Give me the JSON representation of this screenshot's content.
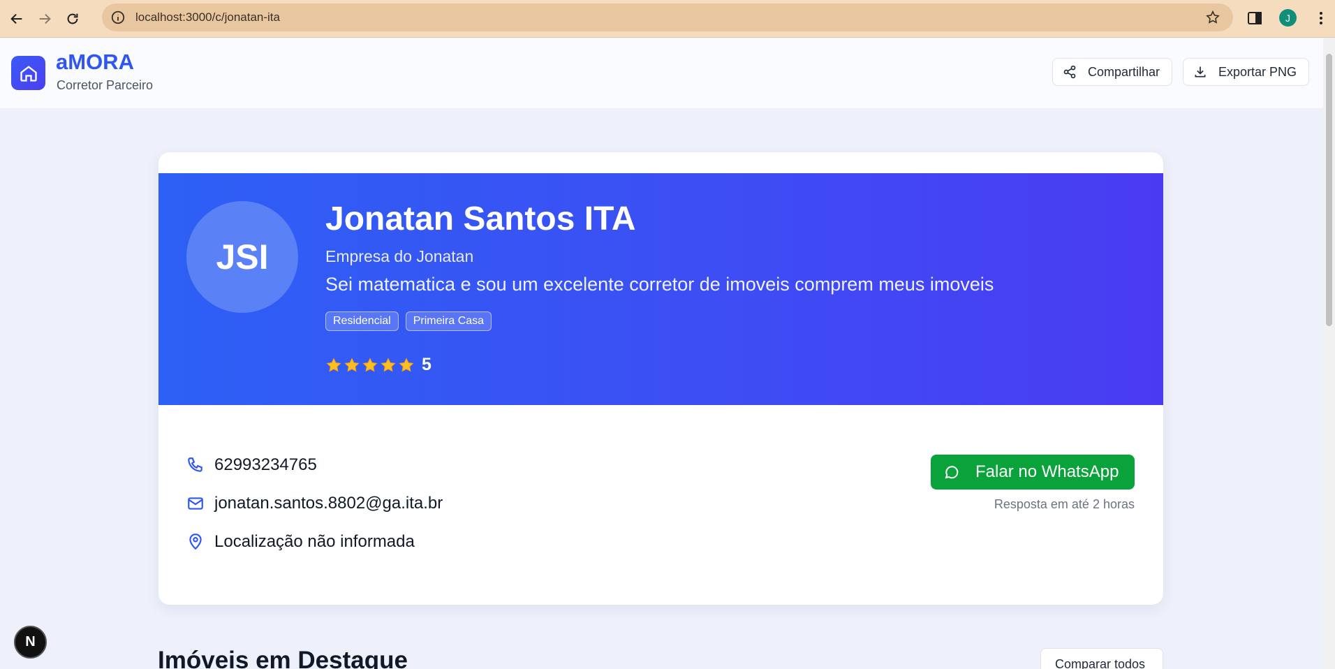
{
  "browser": {
    "url": "localhost:3000/c/jonatan-ita",
    "profile_initial": "J"
  },
  "header": {
    "brand": "aMORA",
    "subtitle": "Corretor Parceiro",
    "share_label": "Compartilhar",
    "export_label": "Exportar PNG"
  },
  "profile": {
    "initials": "JSI",
    "name": "Jonatan Santos ITA",
    "company": "Empresa do Jonatan",
    "bio": "Sei matematica e sou um excelente corretor de imoveis comprem meus imoveis",
    "tags": [
      "Residencial",
      "Primeira Casa"
    ],
    "rating": "5",
    "stars": 5
  },
  "contact": {
    "phone": "62993234765",
    "email": "jonatan.santos.8802@ga.ita.br",
    "location": "Localização não informada"
  },
  "whatsapp": {
    "label": "Falar no WhatsApp",
    "note": "Resposta em até 2 horas"
  },
  "featured": {
    "title": "Imóveis em Destaque",
    "compare_label": "Comparar todos"
  },
  "dev_badge": "N",
  "colors": {
    "brand_blue": "#2f56f2",
    "banner_start": "#2d60f5",
    "banner_end": "#4a3bf2",
    "whatsapp_green": "#0aa33b",
    "star_yellow": "#fbbf24"
  }
}
